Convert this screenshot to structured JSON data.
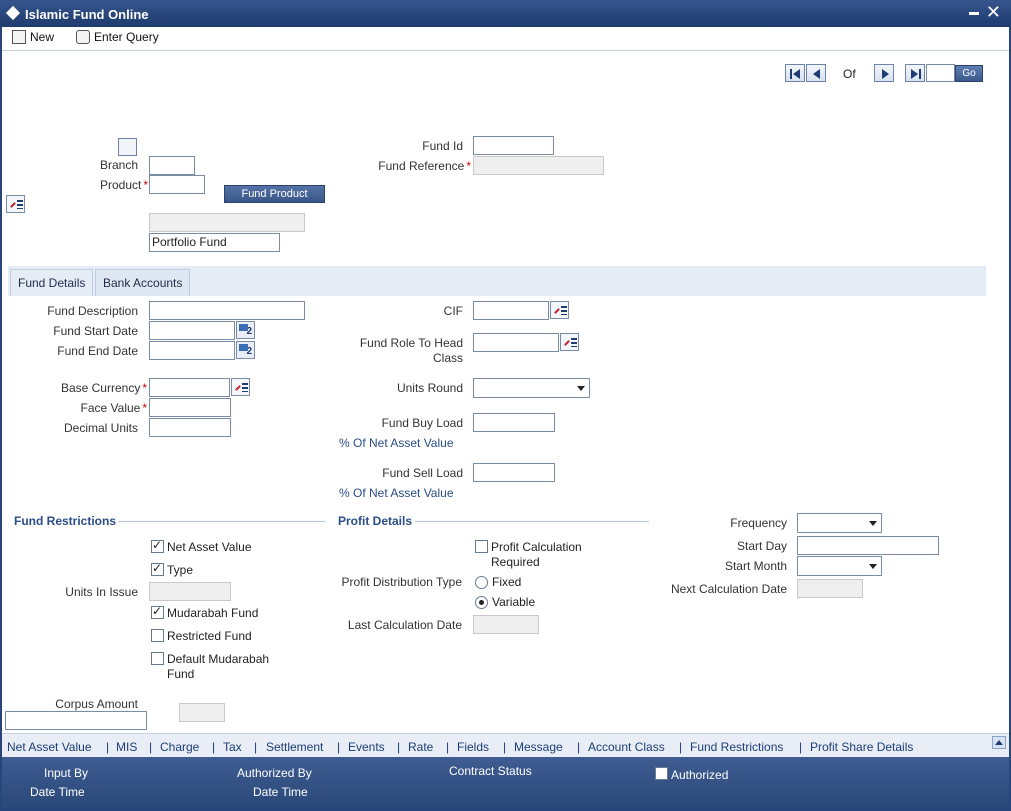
{
  "window": {
    "title": "Islamic Fund Online"
  },
  "toolbar": {
    "new_label": "New",
    "enter_query_label": "Enter Query"
  },
  "navigation": {
    "of_label": "Of",
    "go_label": "Go",
    "page_value": ""
  },
  "header": {
    "fund_id_label": "Fund Id",
    "fund_reference_label": "Fund Reference",
    "branch_label": "Branch",
    "product_label": "Product",
    "fund_product_button": "Fund Product",
    "portfolio_fund_value": "Portfolio Fund",
    "fund_id_value": "",
    "fund_reference_value": "",
    "branch_value": "",
    "product_value": ""
  },
  "tabs": [
    {
      "label": "Fund Details",
      "active": true
    },
    {
      "label": "Bank Accounts",
      "active": false
    }
  ],
  "details": {
    "fund_description_label": "Fund Description",
    "fund_start_date_label": "Fund Start Date",
    "fund_end_date_label": "Fund End Date",
    "base_currency_label": "Base Currency",
    "face_value_label": "Face Value",
    "decimal_units_label": "Decimal Units",
    "cif_label": "CIF",
    "fund_role_label_line1": "Fund Role To Head",
    "fund_role_label_line2": "Class",
    "units_round_label": "Units Round",
    "fund_buy_load_label": "Fund Buy Load",
    "buy_nav_label": "% Of Net Asset Value",
    "fund_sell_load_label": "Fund Sell Load",
    "sell_nav_label": "% Of Net Asset Value",
    "calendar_day": "2"
  },
  "restrictions": {
    "section_title": "Fund Restrictions",
    "net_asset_value_label": "Net Asset Value",
    "type_label": "Type",
    "units_in_issue_label": "Units In Issue",
    "mudarabah_fund_label": "Mudarabah Fund",
    "restricted_fund_label": "Restricted Fund",
    "default_mudarabah_line1": "Default Mudarabah",
    "default_mudarabah_line2": "Fund",
    "corpus_amount_label": "Corpus Amount",
    "net_asset_value_checked": true,
    "type_checked": true,
    "mudarabah_fund_checked": true,
    "restricted_fund_checked": false,
    "default_mudarabah_checked": false
  },
  "profit": {
    "section_title": "Profit Details",
    "calc_required_line1": "Profit Calculation",
    "calc_required_line2": "Required",
    "distribution_type_label": "Profit Distribution Type",
    "fixed_label": "Fixed",
    "variable_label": "Variable",
    "selected_distribution": "Variable",
    "last_calc_date_label": "Last Calculation Date",
    "frequency_label": "Frequency",
    "start_day_label": "Start Day",
    "start_month_label": "Start Month",
    "next_calc_date_label": "Next Calculation Date",
    "calc_required_checked": false
  },
  "subscreens": [
    "Net Asset Value",
    "MIS",
    "Charge",
    "Tax",
    "Settlement",
    "Events",
    "Rate",
    "Fields",
    "Message",
    "Account Class",
    "Fund Restrictions",
    "Profit Share Details"
  ],
  "footer": {
    "input_by_label": "Input By",
    "date_time_label": "Date Time",
    "authorized_by_label": "Authorized By",
    "date_time_label_2": "Date Time",
    "contract_status_label": "Contract Status",
    "authorized_label": "Authorized",
    "authorized_checked": false
  },
  "colors": {
    "title_bar": "#2a4778",
    "accent_text": "#2b4d88",
    "required_marker": "#cc0000",
    "tab_bar": "#e6ecf5"
  },
  "icons": {
    "lov": "list-of-values-icon",
    "calendar": "calendar-icon",
    "first": "first-record-icon",
    "previous": "previous-record-icon",
    "next": "next-record-icon",
    "last": "last-record-icon"
  }
}
